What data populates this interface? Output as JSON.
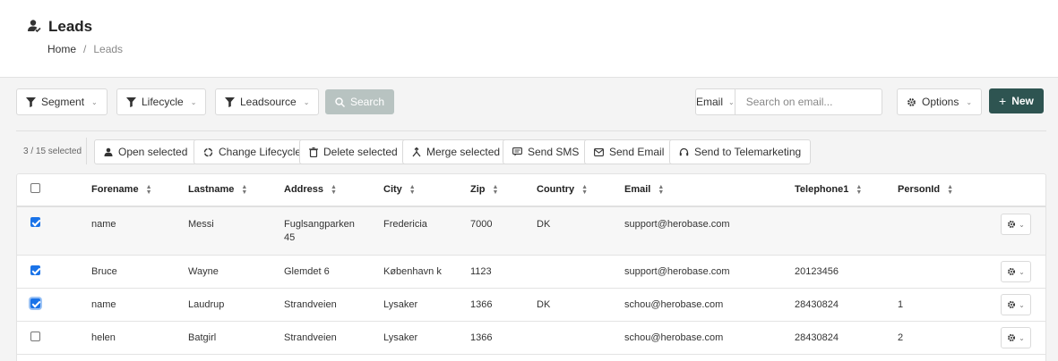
{
  "page": {
    "title": "Leads"
  },
  "breadcrumb": {
    "home": "Home",
    "separator": "/",
    "current": "Leads"
  },
  "filters": {
    "segment": "Segment",
    "lifecycle": "Lifecycle",
    "leadsource": "Leadsource",
    "search": "Search"
  },
  "email_search": {
    "field": "Email",
    "placeholder": "Search on email..."
  },
  "options_label": "Options",
  "new_label": "New",
  "selection": {
    "count_text": "3 / 15 selected"
  },
  "bulk_actions": {
    "open": "Open selected",
    "change_lifecycle": "Change Lifecycle",
    "delete": "Delete selected",
    "merge": "Merge selected",
    "sms": "Send SMS",
    "email": "Send Email",
    "telemarketing": "Send to Telemarketing"
  },
  "columns": {
    "forename": "Forename",
    "lastname": "Lastname",
    "address": "Address",
    "city": "City",
    "zip": "Zip",
    "country": "Country",
    "email": "Email",
    "telephone": "Telephone1",
    "personid": "PersonId"
  },
  "rows": [
    {
      "checked": true,
      "forename": "name",
      "lastname": "Messi",
      "address": "Fuglsangparken 45",
      "city": "Fredericia",
      "zip": "7000",
      "country": "DK",
      "email": "support@herobase.com",
      "telephone": "",
      "personid": ""
    },
    {
      "checked": true,
      "forename": "Bruce",
      "lastname": "Wayne",
      "address": "Glemdet 6",
      "city": "København k",
      "zip": "1123",
      "country": "",
      "email": "support@herobase.com",
      "telephone": "20123456",
      "personid": ""
    },
    {
      "checked": true,
      "forename": "name",
      "lastname": "Laudrup",
      "address": "Strandveien",
      "city": "Lysaker",
      "zip": "1366",
      "country": "DK",
      "email": "schou@herobase.com",
      "telephone": "28430824",
      "personid": "1"
    },
    {
      "checked": false,
      "forename": "helen",
      "lastname": "Batgirl",
      "address": "Strandveien",
      "city": "Lysaker",
      "zip": "1366",
      "country": "",
      "email": "schou@herobase.com",
      "telephone": "28430824",
      "personid": "2"
    }
  ],
  "colors": {
    "primary": "#2e5451",
    "checkbox": "#1a73e8"
  }
}
